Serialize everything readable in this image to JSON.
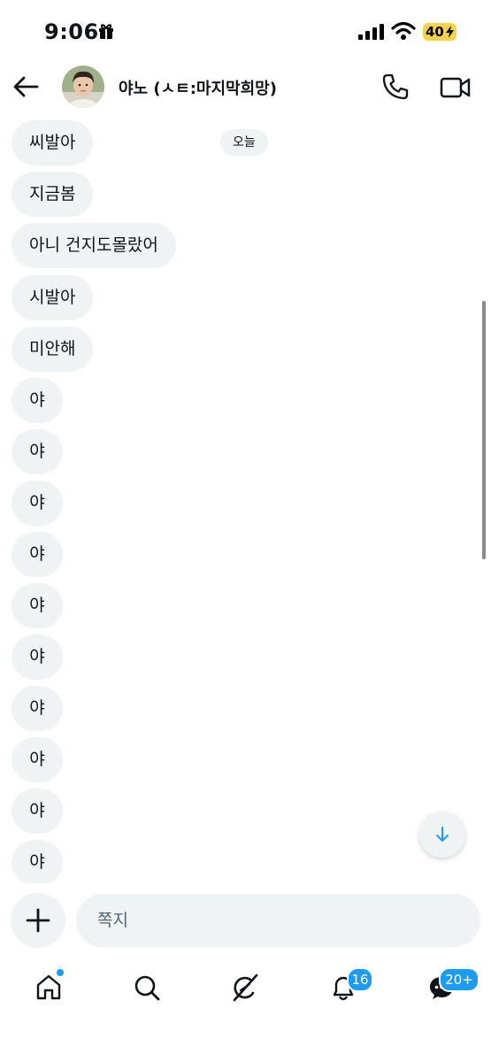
{
  "status_bar": {
    "time": "9:06",
    "battery": "40",
    "battery_color": "#f3d34a"
  },
  "header": {
    "contact_name": "야노 (ㅅㅌ:마지막희망)",
    "icons": [
      "back-arrow-icon",
      "phone-icon",
      "video-icon"
    ]
  },
  "conversation": {
    "date_label": "오늘",
    "messages": [
      "씨발아",
      "지금봄",
      "아니 건지도몰랐어",
      "시발아",
      "미안해",
      "야",
      "야",
      "야",
      "야",
      "야",
      "야",
      "야",
      "야",
      "야",
      "야"
    ]
  },
  "composer": {
    "placeholder": "쪽지",
    "value": ""
  },
  "bottom_nav": {
    "items": [
      "home-icon",
      "search-icon",
      "grok-icon",
      "notifications-icon",
      "messages-icon"
    ],
    "notifications_badge": "16",
    "messages_badge": "20+"
  },
  "colors": {
    "accent": "#1d9bf0",
    "bubble_bg": "#eff3f4",
    "text": "#0f1419"
  }
}
